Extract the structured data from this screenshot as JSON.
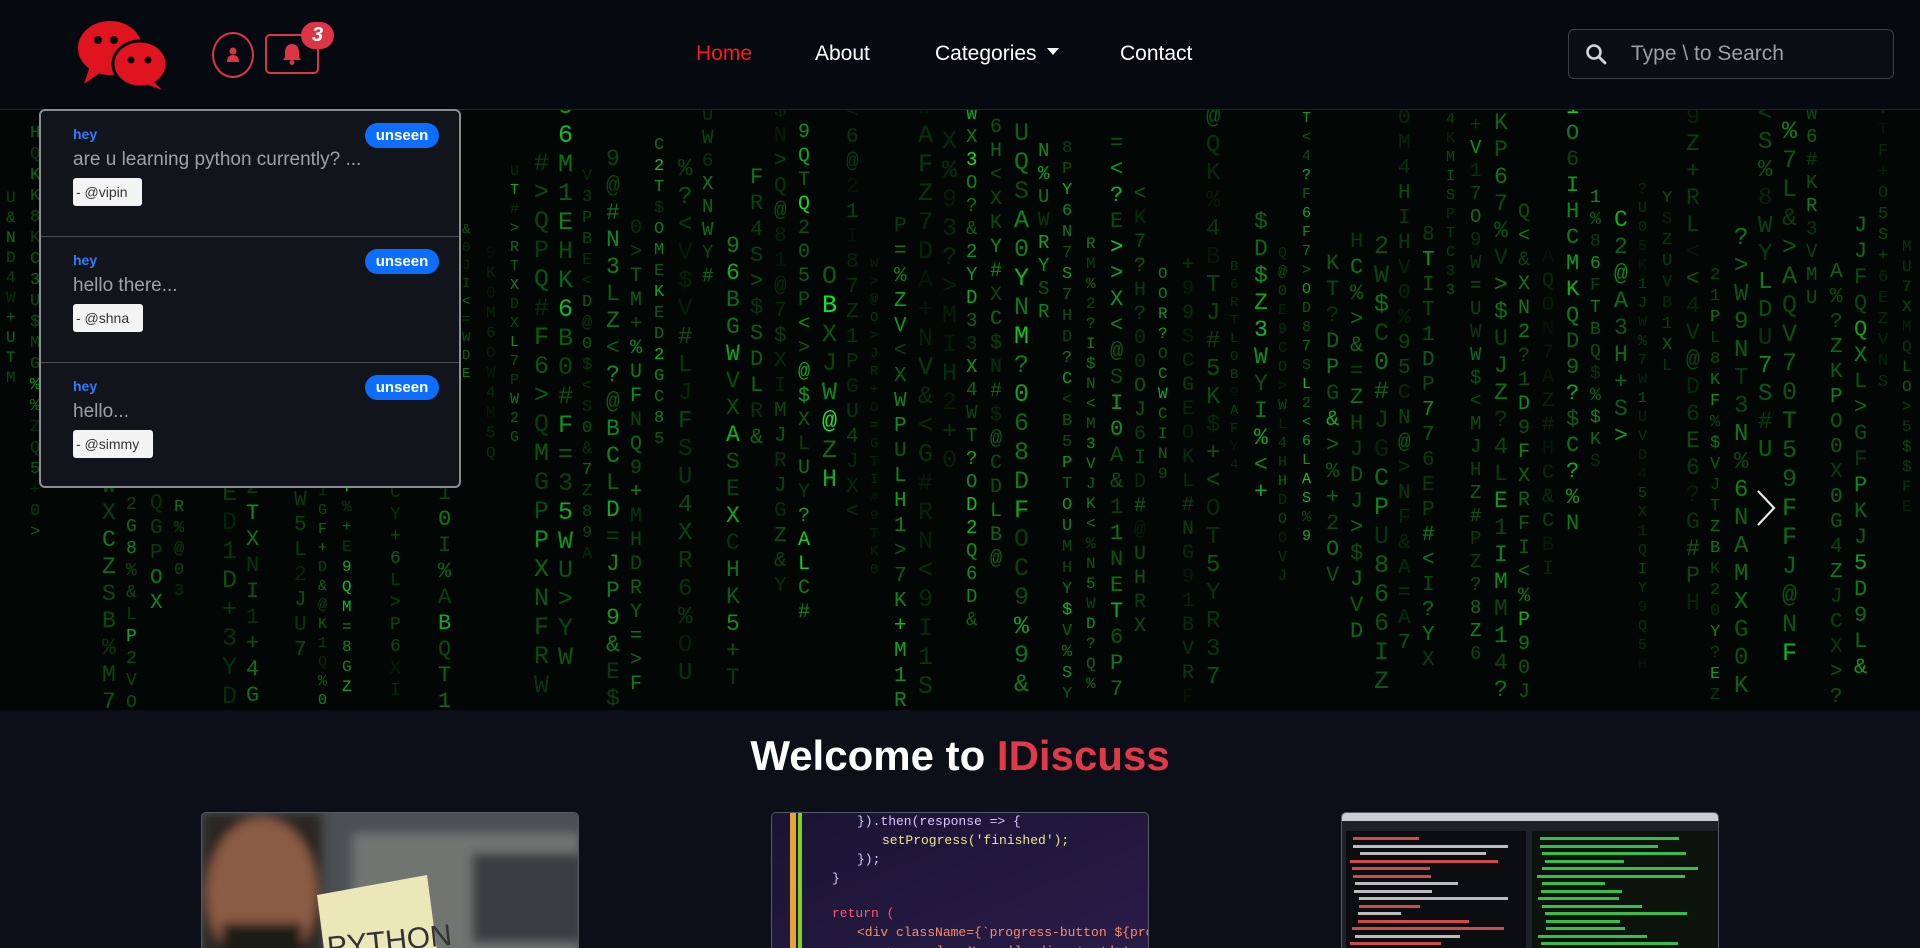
{
  "nav": {
    "links": [
      "Home",
      "About",
      "Categories",
      "Contact"
    ],
    "active": "Home",
    "notification_count": "3",
    "search_placeholder": "Type \\ to Search"
  },
  "notifications": [
    {
      "title": "hey",
      "status": "unseen",
      "message": "are u learning python currently? ...",
      "user": "- @vipin"
    },
    {
      "title": "hey",
      "status": "unseen",
      "message": "hello there...",
      "user": "- @shna"
    },
    {
      "title": "hey",
      "status": "unseen",
      "message": "hello...",
      "user": "- @simmy"
    }
  ],
  "welcome": {
    "prefix": "Welcome to ",
    "brand": "IDiscuss"
  },
  "cards": [
    {
      "image": "python-learner-photo"
    },
    {
      "image": "javascript-code-photo"
    },
    {
      "image": "terminal-code-photo"
    }
  ],
  "colors": {
    "accent": "#dc3545",
    "nav_active": "#ff1a1a",
    "badge_blue": "#0d6efd",
    "matrix_green": "#22c55e",
    "background": "#0c0f17"
  }
}
